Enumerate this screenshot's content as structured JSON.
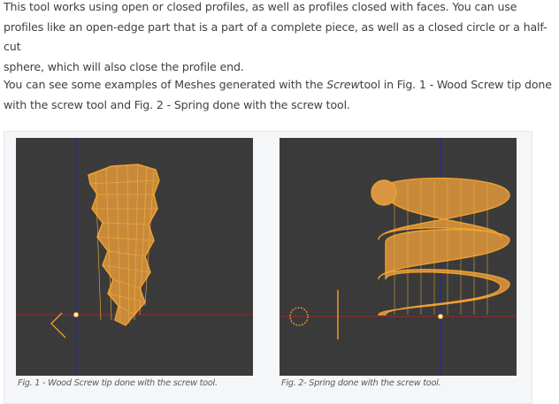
{
  "intro": {
    "line1": "This tool works using open or closed profiles, as well as profiles closed with faces. You can use",
    "line2": "profiles like an open-edge part that is a part of a complete piece, as well as a closed circle or a half-cut",
    "line3": "sphere, which will also close the profile end."
  },
  "examples": {
    "line1_pre": "You can see some examples of Meshes generated with the ",
    "line1_em": "Screw",
    "line1_post": "tool in Fig. 1 - Wood Screw tip done",
    "line2": "with the screw tool and Fig. 2 - Spring done with the screw tool."
  },
  "figures": [
    {
      "caption": "Fig. 1 - Wood Screw tip done with the screw tool.",
      "icon": "wood-screw-mesh"
    },
    {
      "caption": "Fig. 2- Spring done with the screw tool.",
      "icon": "spring-mesh"
    }
  ],
  "colors": {
    "viewport_bg": "#3a3a3a",
    "mesh_orange": "#f0a030",
    "axis_red": "#9a2a2a",
    "axis_blue": "#2a2a8a"
  }
}
